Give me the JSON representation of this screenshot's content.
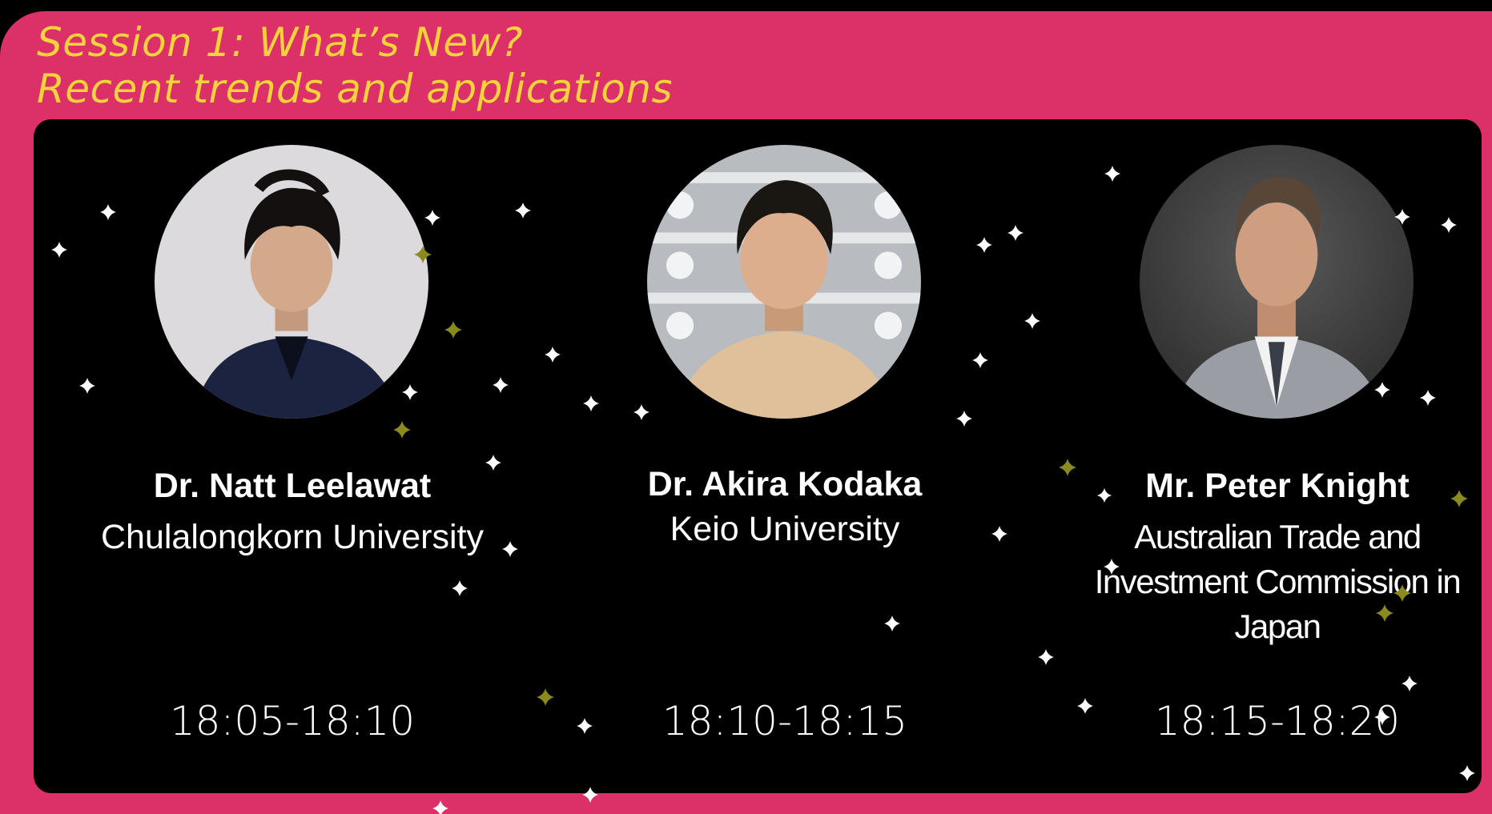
{
  "session": {
    "title_line1": "Session 1: What’s New?",
    "title_line2": "Recent trends and applications"
  },
  "colors": {
    "frame": "#db3068",
    "title": "#f6d33c",
    "panel": "#000000",
    "text": "#ffffff",
    "star_white": "#ffffff",
    "star_olive": "#8a8a1e"
  },
  "speakers": [
    {
      "name": "Dr. Natt Leelawat",
      "affiliation": "Chulalongkorn University",
      "time": "18:05-18:10",
      "photo": "speaker-photo-natt-leelawat"
    },
    {
      "name": "Dr. Akira Kodaka",
      "affiliation": "Keio University",
      "time": "18:10-18:15",
      "photo": "speaker-photo-akira-kodaka"
    },
    {
      "name": "Mr. Peter Knight",
      "affiliation": "Australian Trade and Investment Commission in Japan",
      "time": "18:15-18:20",
      "photo": "speaker-photo-peter-knight"
    }
  ],
  "decoration": {
    "icon": "sparkle-star-icon"
  }
}
